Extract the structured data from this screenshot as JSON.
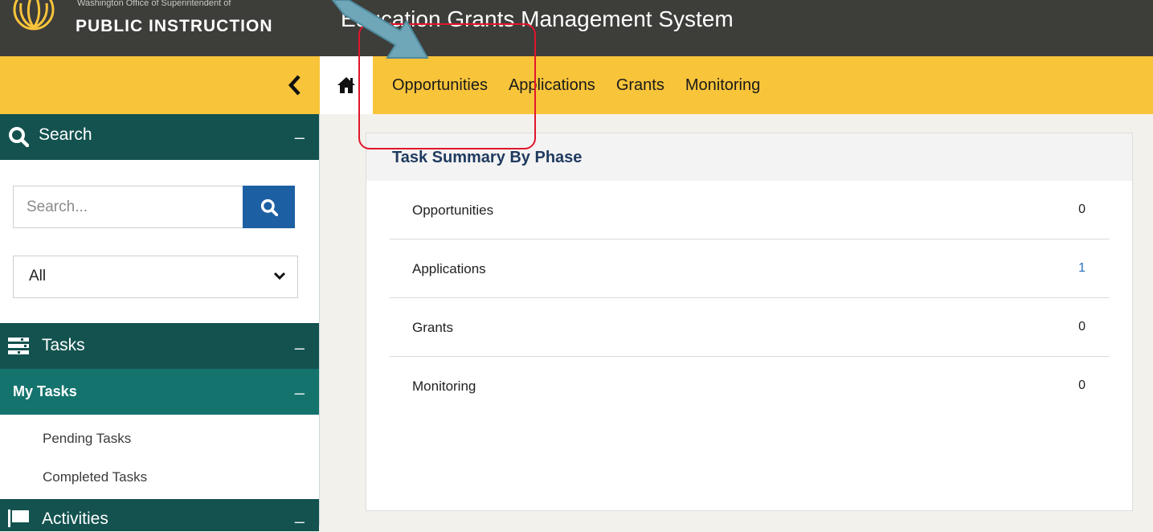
{
  "header": {
    "org_small": "Washington Office of Superintendent of",
    "org_big": "PUBLIC INSTRUCTION",
    "app_title": "Education Grants Management System"
  },
  "nav": {
    "items": [
      "Opportunities",
      "Applications",
      "Grants",
      "Monitoring"
    ]
  },
  "sidebar": {
    "search": {
      "title": "Search",
      "placeholder": "Search...",
      "filter_value": "All",
      "collapse_symbol": "–"
    },
    "tasks": {
      "title": "Tasks",
      "collapse_symbol": "–"
    },
    "my_tasks": {
      "title": "My Tasks",
      "collapse_symbol": "–"
    },
    "task_links": [
      "Pending Tasks",
      "Completed Tasks"
    ],
    "activities": {
      "title": "Activities",
      "collapse_symbol": "–"
    }
  },
  "task_summary": {
    "title": "Task Summary By Phase",
    "rows": [
      {
        "label": "Opportunities",
        "count": "0"
      },
      {
        "label": "Applications",
        "count": "1"
      },
      {
        "label": "Grants",
        "count": "0"
      },
      {
        "label": "Monitoring",
        "count": "0"
      }
    ]
  },
  "colors": {
    "header_bg": "#3d3d3a",
    "nav_bar": "#f8c43a",
    "sidebar_header": "#13524f",
    "search_button": "#1d5fa3",
    "highlight": "#e0162b",
    "arrow": "#6fa7b8"
  }
}
